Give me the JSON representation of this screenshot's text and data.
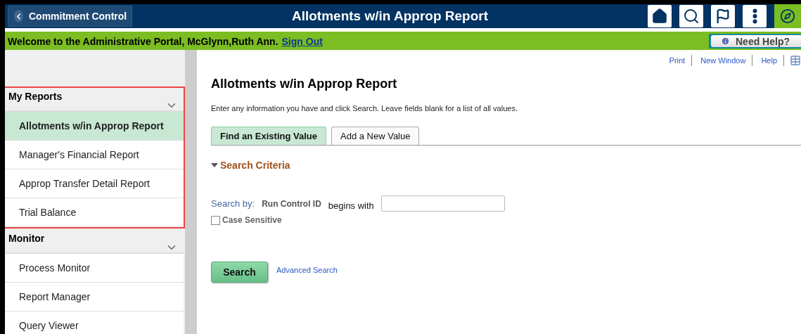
{
  "header": {
    "back_label": "Commitment Control",
    "title": "Allotments w/in Approp Report"
  },
  "welcome": {
    "text": "Welcome to the Administrative Portal, McGlynn,Ruth Ann.",
    "link": "Sign Out",
    "help": "Need Help?"
  },
  "sidebar": {
    "groups": [
      {
        "title": "My Reports",
        "expanded": true,
        "highlighted": true,
        "items": [
          {
            "label": "Allotments w/in Approp Report",
            "selected": true
          },
          {
            "label": "Manager's Financial Report",
            "selected": false
          },
          {
            "label": "Approp Transfer Detail Report",
            "selected": false
          },
          {
            "label": "Trial Balance",
            "selected": false
          }
        ]
      },
      {
        "title": "Monitor",
        "expanded": true,
        "highlighted": false,
        "items": [
          {
            "label": "Process Monitor",
            "selected": false
          },
          {
            "label": "Report Manager",
            "selected": false
          },
          {
            "label": "Query Viewer",
            "selected": false
          }
        ]
      }
    ]
  },
  "page_links": [
    "Print",
    "New Window",
    "Help"
  ],
  "page_title": "Allotments w/in Approp Report",
  "instructions": "Enter any information you have and click Search. Leave fields blank for a list of all values.",
  "tabs": [
    {
      "label": "Find an Existing Value",
      "selected": true
    },
    {
      "label": "Add a New Value",
      "selected": false
    }
  ],
  "search_criteria": {
    "title": "Search Criteria",
    "expanded": true,
    "search_by": "Search by:",
    "field_label": "Run Control ID",
    "operator": "begins with",
    "case_sensitive": {
      "label": "Case Sensitive",
      "checked": false
    }
  },
  "buttons": {
    "search": "Search",
    "advanced": "Advanced Search"
  }
}
